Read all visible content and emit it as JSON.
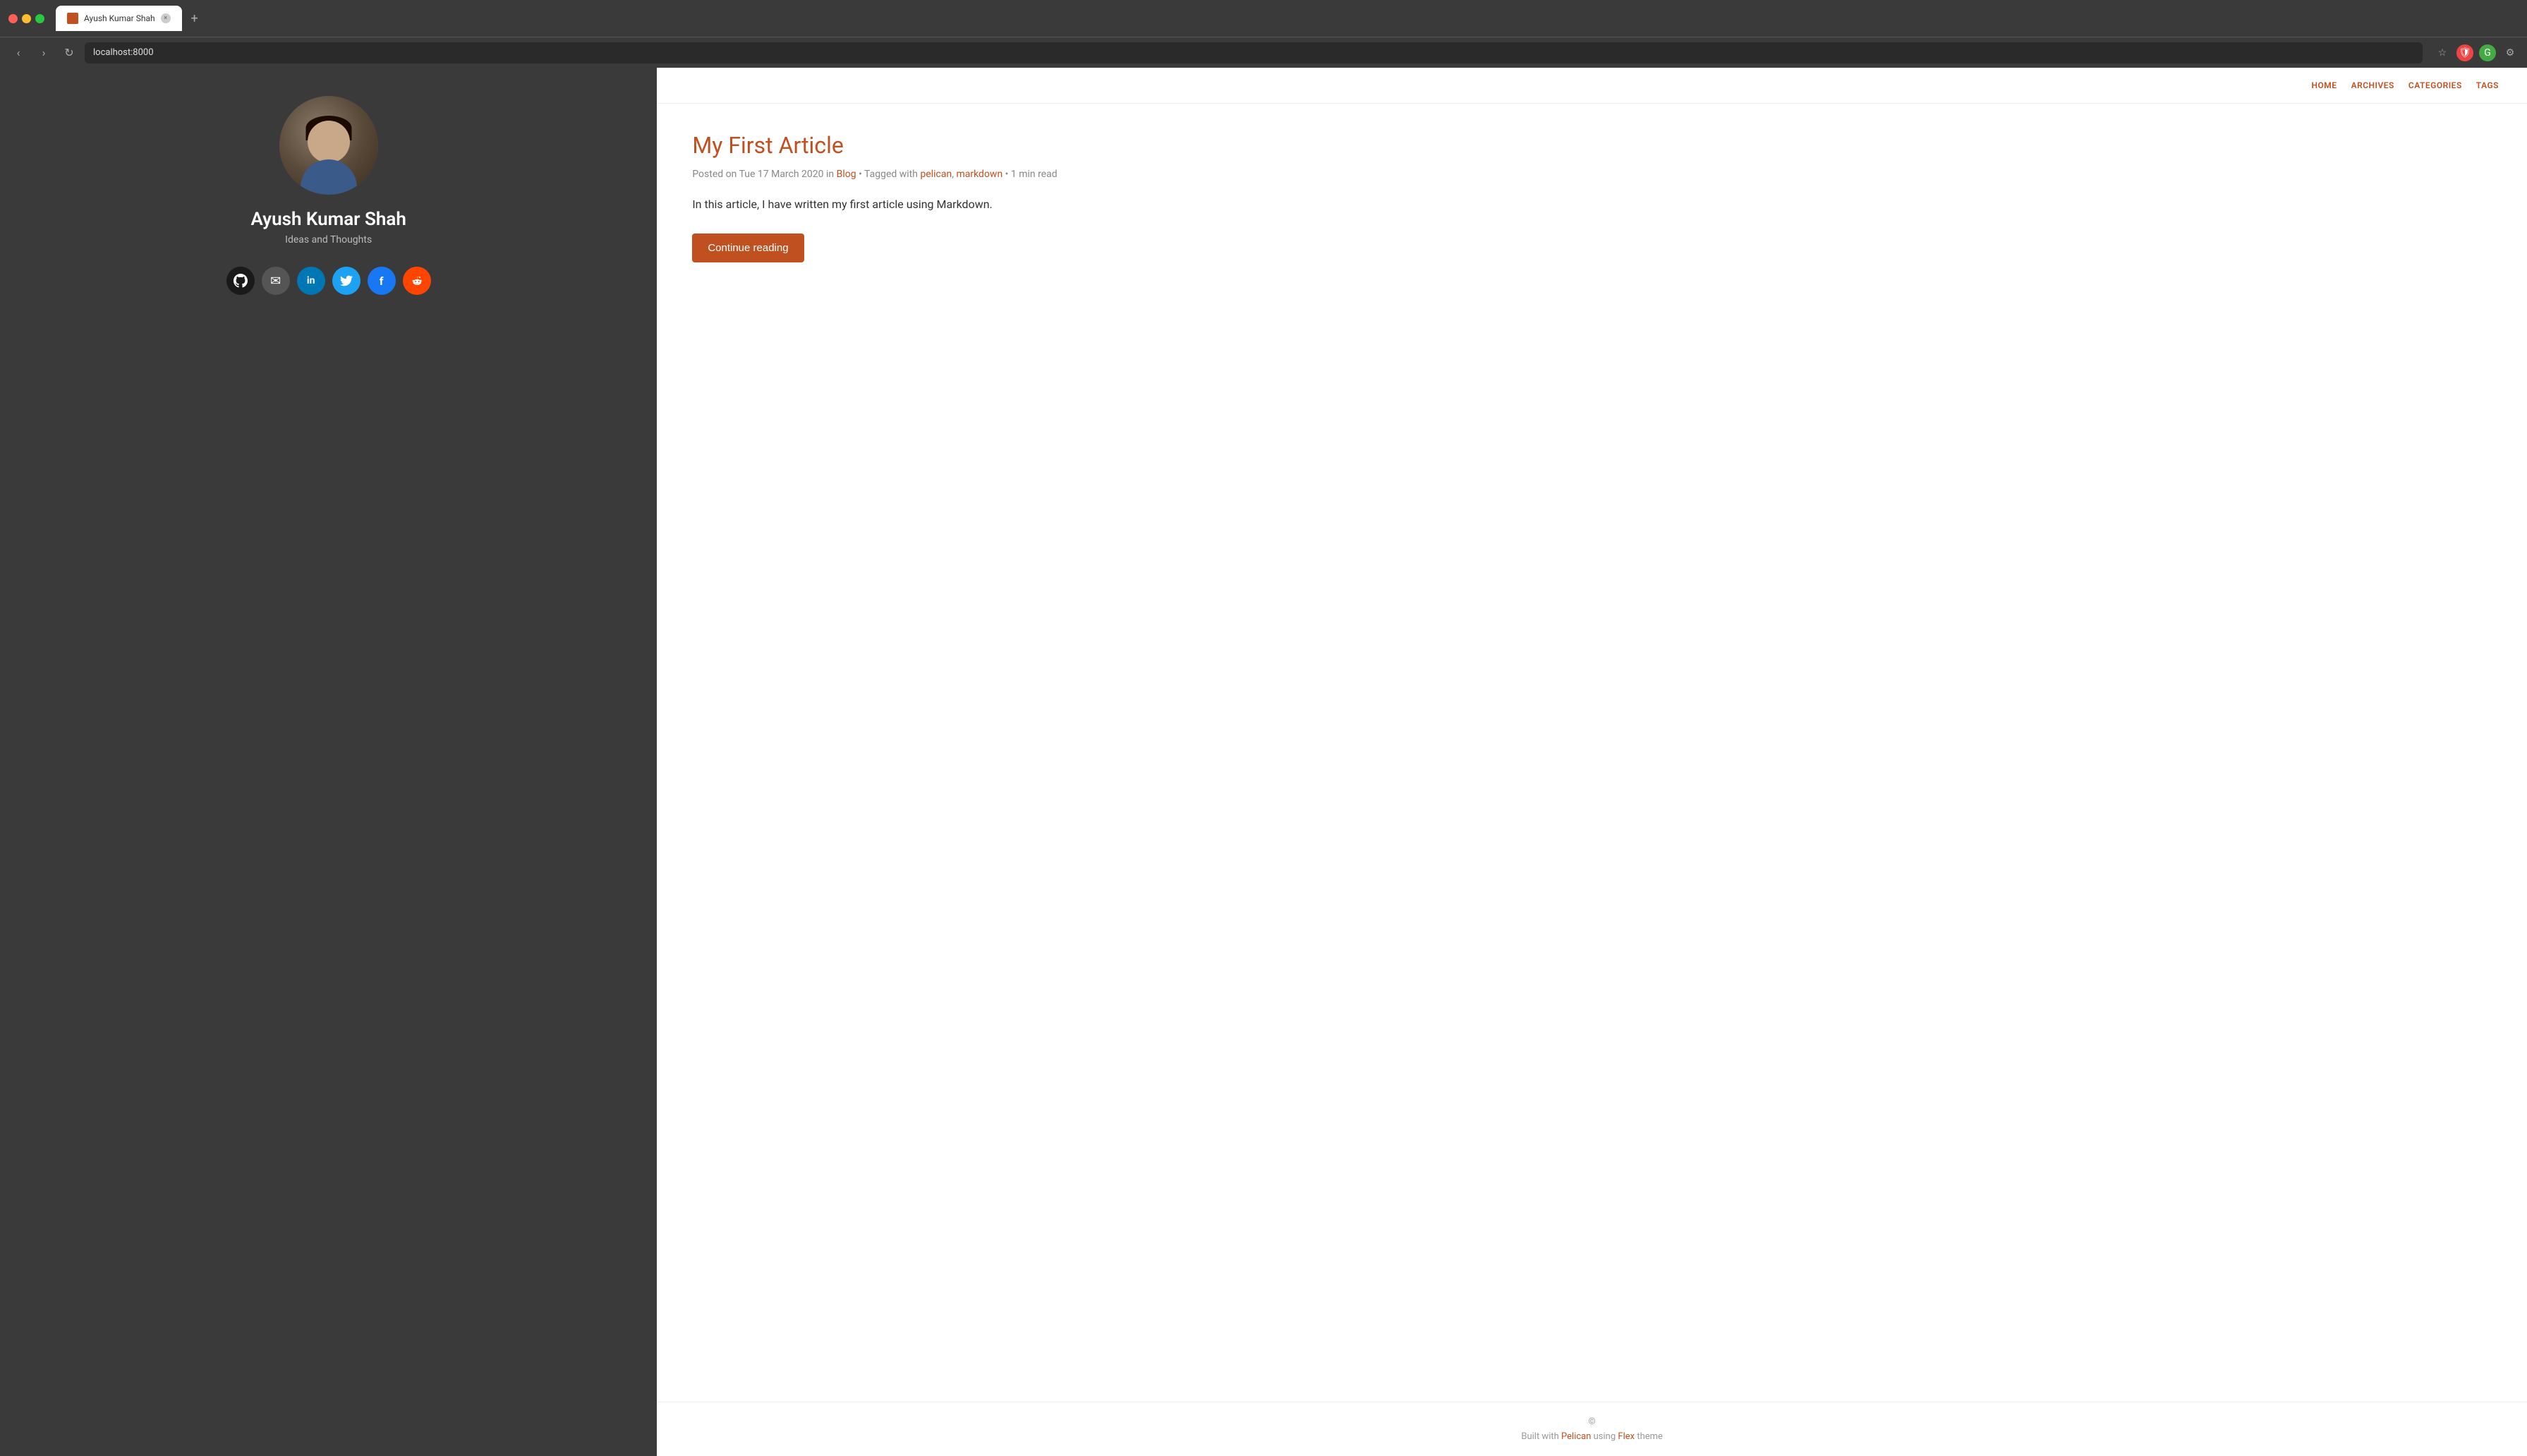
{
  "browser": {
    "tab_title": "Ayush Kumar Shah",
    "url": "localhost:8000",
    "new_tab_symbol": "+"
  },
  "nav": {
    "items": [
      {
        "label": "HOME",
        "id": "home"
      },
      {
        "label": "ARCHIVES",
        "id": "archives"
      },
      {
        "label": "CATEGORIES",
        "id": "categories"
      },
      {
        "label": "TAGS",
        "id": "tags"
      }
    ]
  },
  "sidebar": {
    "name": "Ayush Kumar Shah",
    "tagline": "Ideas and Thoughts",
    "social_links": [
      {
        "id": "github",
        "symbol": "🐙",
        "label": "GitHub",
        "class": "si-github"
      },
      {
        "id": "email",
        "symbol": "✉",
        "label": "Email",
        "class": "si-email"
      },
      {
        "id": "linkedin",
        "symbol": "in",
        "label": "LinkedIn",
        "class": "si-linkedin"
      },
      {
        "id": "twitter",
        "symbol": "🐦",
        "label": "Twitter",
        "class": "si-twitter"
      },
      {
        "id": "facebook",
        "symbol": "f",
        "label": "Facebook",
        "class": "si-facebook"
      },
      {
        "id": "reddit",
        "symbol": "👾",
        "label": "Reddit",
        "class": "si-reddit"
      }
    ]
  },
  "article": {
    "title": "My First Article",
    "meta_prefix": "Posted on",
    "date": "Tue 17 March 2020",
    "meta_in": "in",
    "category": "Blog",
    "meta_tagged": "• Tagged with",
    "tags": [
      "pelican",
      "markdown"
    ],
    "meta_read": "• 1 min read",
    "excerpt": "In this article, I have written my first article using Markdown.",
    "continue_label": "Continue reading"
  },
  "footer": {
    "copyright": "©",
    "built_prefix": "Built with",
    "pelican_label": "Pelican",
    "using": "using",
    "flex_label": "Flex",
    "theme_suffix": "theme"
  }
}
